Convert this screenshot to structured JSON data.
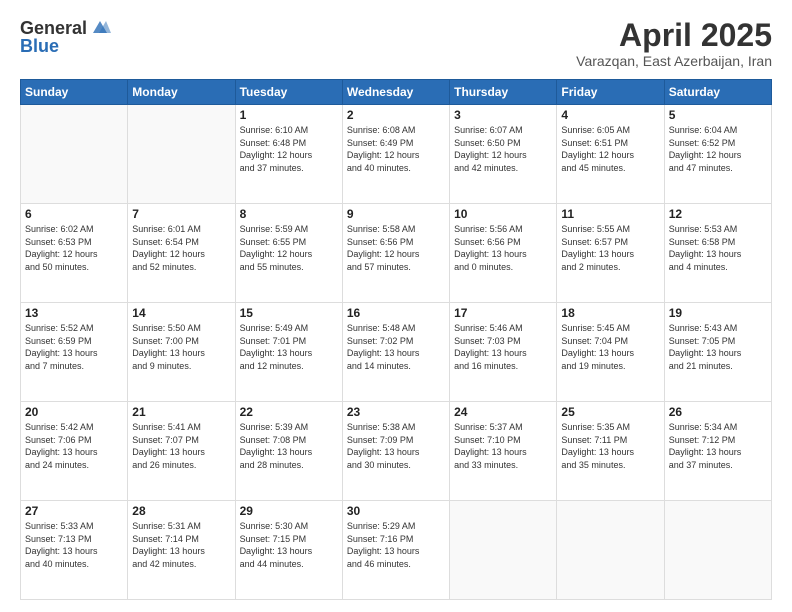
{
  "header": {
    "logo_general": "General",
    "logo_blue": "Blue",
    "title": "April 2025",
    "location": "Varazqan, East Azerbaijan, Iran"
  },
  "weekdays": [
    "Sunday",
    "Monday",
    "Tuesday",
    "Wednesday",
    "Thursday",
    "Friday",
    "Saturday"
  ],
  "weeks": [
    [
      {
        "day": "",
        "content": ""
      },
      {
        "day": "",
        "content": ""
      },
      {
        "day": "1",
        "content": "Sunrise: 6:10 AM\nSunset: 6:48 PM\nDaylight: 12 hours\nand 37 minutes."
      },
      {
        "day": "2",
        "content": "Sunrise: 6:08 AM\nSunset: 6:49 PM\nDaylight: 12 hours\nand 40 minutes."
      },
      {
        "day": "3",
        "content": "Sunrise: 6:07 AM\nSunset: 6:50 PM\nDaylight: 12 hours\nand 42 minutes."
      },
      {
        "day": "4",
        "content": "Sunrise: 6:05 AM\nSunset: 6:51 PM\nDaylight: 12 hours\nand 45 minutes."
      },
      {
        "day": "5",
        "content": "Sunrise: 6:04 AM\nSunset: 6:52 PM\nDaylight: 12 hours\nand 47 minutes."
      }
    ],
    [
      {
        "day": "6",
        "content": "Sunrise: 6:02 AM\nSunset: 6:53 PM\nDaylight: 12 hours\nand 50 minutes."
      },
      {
        "day": "7",
        "content": "Sunrise: 6:01 AM\nSunset: 6:54 PM\nDaylight: 12 hours\nand 52 minutes."
      },
      {
        "day": "8",
        "content": "Sunrise: 5:59 AM\nSunset: 6:55 PM\nDaylight: 12 hours\nand 55 minutes."
      },
      {
        "day": "9",
        "content": "Sunrise: 5:58 AM\nSunset: 6:56 PM\nDaylight: 12 hours\nand 57 minutes."
      },
      {
        "day": "10",
        "content": "Sunrise: 5:56 AM\nSunset: 6:56 PM\nDaylight: 13 hours\nand 0 minutes."
      },
      {
        "day": "11",
        "content": "Sunrise: 5:55 AM\nSunset: 6:57 PM\nDaylight: 13 hours\nand 2 minutes."
      },
      {
        "day": "12",
        "content": "Sunrise: 5:53 AM\nSunset: 6:58 PM\nDaylight: 13 hours\nand 4 minutes."
      }
    ],
    [
      {
        "day": "13",
        "content": "Sunrise: 5:52 AM\nSunset: 6:59 PM\nDaylight: 13 hours\nand 7 minutes."
      },
      {
        "day": "14",
        "content": "Sunrise: 5:50 AM\nSunset: 7:00 PM\nDaylight: 13 hours\nand 9 minutes."
      },
      {
        "day": "15",
        "content": "Sunrise: 5:49 AM\nSunset: 7:01 PM\nDaylight: 13 hours\nand 12 minutes."
      },
      {
        "day": "16",
        "content": "Sunrise: 5:48 AM\nSunset: 7:02 PM\nDaylight: 13 hours\nand 14 minutes."
      },
      {
        "day": "17",
        "content": "Sunrise: 5:46 AM\nSunset: 7:03 PM\nDaylight: 13 hours\nand 16 minutes."
      },
      {
        "day": "18",
        "content": "Sunrise: 5:45 AM\nSunset: 7:04 PM\nDaylight: 13 hours\nand 19 minutes."
      },
      {
        "day": "19",
        "content": "Sunrise: 5:43 AM\nSunset: 7:05 PM\nDaylight: 13 hours\nand 21 minutes."
      }
    ],
    [
      {
        "day": "20",
        "content": "Sunrise: 5:42 AM\nSunset: 7:06 PM\nDaylight: 13 hours\nand 24 minutes."
      },
      {
        "day": "21",
        "content": "Sunrise: 5:41 AM\nSunset: 7:07 PM\nDaylight: 13 hours\nand 26 minutes."
      },
      {
        "day": "22",
        "content": "Sunrise: 5:39 AM\nSunset: 7:08 PM\nDaylight: 13 hours\nand 28 minutes."
      },
      {
        "day": "23",
        "content": "Sunrise: 5:38 AM\nSunset: 7:09 PM\nDaylight: 13 hours\nand 30 minutes."
      },
      {
        "day": "24",
        "content": "Sunrise: 5:37 AM\nSunset: 7:10 PM\nDaylight: 13 hours\nand 33 minutes."
      },
      {
        "day": "25",
        "content": "Sunrise: 5:35 AM\nSunset: 7:11 PM\nDaylight: 13 hours\nand 35 minutes."
      },
      {
        "day": "26",
        "content": "Sunrise: 5:34 AM\nSunset: 7:12 PM\nDaylight: 13 hours\nand 37 minutes."
      }
    ],
    [
      {
        "day": "27",
        "content": "Sunrise: 5:33 AM\nSunset: 7:13 PM\nDaylight: 13 hours\nand 40 minutes."
      },
      {
        "day": "28",
        "content": "Sunrise: 5:31 AM\nSunset: 7:14 PM\nDaylight: 13 hours\nand 42 minutes."
      },
      {
        "day": "29",
        "content": "Sunrise: 5:30 AM\nSunset: 7:15 PM\nDaylight: 13 hours\nand 44 minutes."
      },
      {
        "day": "30",
        "content": "Sunrise: 5:29 AM\nSunset: 7:16 PM\nDaylight: 13 hours\nand 46 minutes."
      },
      {
        "day": "",
        "content": ""
      },
      {
        "day": "",
        "content": ""
      },
      {
        "day": "",
        "content": ""
      }
    ]
  ]
}
